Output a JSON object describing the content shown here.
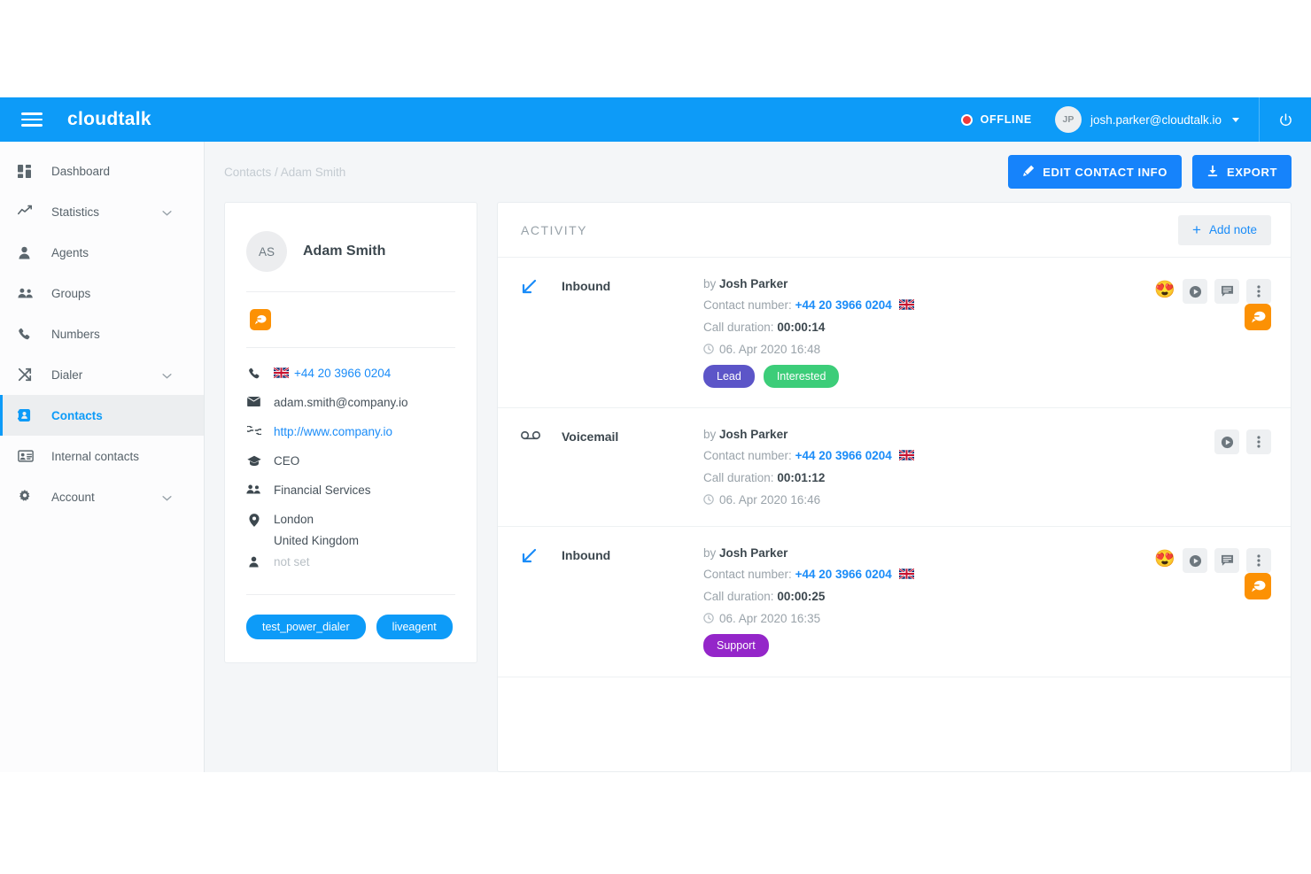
{
  "topbar": {
    "brand": "cloudtalk",
    "menu_icon": "hamburger-icon",
    "status_label": "OFFLINE",
    "user_initials": "JP",
    "user_email": "josh.parker@cloudtalk.io",
    "power_icon": "power-icon",
    "accent": "#0d9bf8"
  },
  "sidebar": {
    "items": [
      {
        "label": "Dashboard",
        "icon": "dashboard-icon",
        "chevron": "",
        "active": false
      },
      {
        "label": "Statistics",
        "icon": "statistics-icon",
        "chevron": "⌄",
        "active": false
      },
      {
        "label": "Agents",
        "icon": "agent-icon",
        "chevron": "",
        "active": false
      },
      {
        "label": "Groups",
        "icon": "groups-icon",
        "chevron": "",
        "active": false
      },
      {
        "label": "Numbers",
        "icon": "phone-icon",
        "chevron": "",
        "active": false
      },
      {
        "label": "Dialer",
        "icon": "dialer-icon",
        "chevron": "⌄",
        "active": false
      },
      {
        "label": "Contacts",
        "icon": "contacts-icon",
        "chevron": "",
        "active": true
      },
      {
        "label": "Internal contacts",
        "icon": "internal-contacts-icon",
        "chevron": "",
        "active": false
      },
      {
        "label": "Account",
        "icon": "gear-icon",
        "chevron": "⌄",
        "active": false
      }
    ]
  },
  "header": {
    "breadcrumb": "Contacts / Adam Smith",
    "edit_label": "EDIT CONTACT INFO",
    "export_label": "EXPORT"
  },
  "contact_card": {
    "initials": "AS",
    "name": "Adam Smith",
    "chat_badge_icon": "chat-bubble-icon",
    "details": [
      {
        "icon": "phone-icon",
        "value": "+44 20 3966 0204",
        "style": "link",
        "flag": "uk"
      },
      {
        "icon": "mail-icon",
        "value": "adam.smith@company.io",
        "style": "",
        "flag": ""
      },
      {
        "icon": "link-icon",
        "value": "http://www.company.io",
        "style": "link",
        "flag": ""
      },
      {
        "icon": "graduation-cap-icon",
        "value": "CEO",
        "style": "",
        "flag": ""
      },
      {
        "icon": "groups-icon",
        "value": "Financial Services",
        "style": "",
        "flag": ""
      },
      {
        "icon": "location-pin-icon",
        "value": "London",
        "value2": "United Kingdom",
        "style": "",
        "flag": ""
      },
      {
        "icon": "person-icon",
        "value": "not set",
        "style": "muted",
        "flag": ""
      }
    ],
    "tags": [
      "test_power_dialer",
      "liveagent"
    ]
  },
  "activity": {
    "title": "ACTIVITY",
    "add_note_label": "Add note",
    "labels": {
      "by": "by",
      "contact_number": "Contact number:",
      "call_duration": "Call duration:"
    },
    "rows": [
      {
        "direction_icon": "arrow-inbound-icon",
        "type": "Inbound",
        "agent": "Josh Parker",
        "number": "+44 20 3966 0204",
        "flag": "uk",
        "duration": "00:00:14",
        "timestamp": "06. Apr 2020 16:48",
        "tags": [
          {
            "label": "Lead",
            "color": "#5c55c8"
          },
          {
            "label": "Interested",
            "color": "#3ccd79"
          }
        ],
        "actions": [
          "heart-eyes-emoji",
          "play-icon",
          "comment-icon",
          "more-vertical-icon"
        ],
        "orange_badge": true
      },
      {
        "direction_icon": "voicemail-icon",
        "type": "Voicemail",
        "agent": "Josh Parker",
        "number": "+44 20 3966 0204",
        "flag": "uk",
        "duration": "00:01:12",
        "timestamp": "06. Apr 2020 16:46",
        "tags": [],
        "actions": [
          "play-icon",
          "more-vertical-icon"
        ],
        "orange_badge": false
      },
      {
        "direction_icon": "arrow-inbound-icon",
        "type": "Inbound",
        "agent": "Josh Parker",
        "number": "+44 20 3966 0204",
        "flag": "uk",
        "duration": "00:00:25",
        "timestamp": "06. Apr 2020 16:35",
        "tags": [
          {
            "label": "Support",
            "color": "#9426c9"
          }
        ],
        "actions": [
          "heart-eyes-emoji",
          "play-icon",
          "comment-icon",
          "more-vertical-icon"
        ],
        "orange_badge": true
      }
    ]
  }
}
